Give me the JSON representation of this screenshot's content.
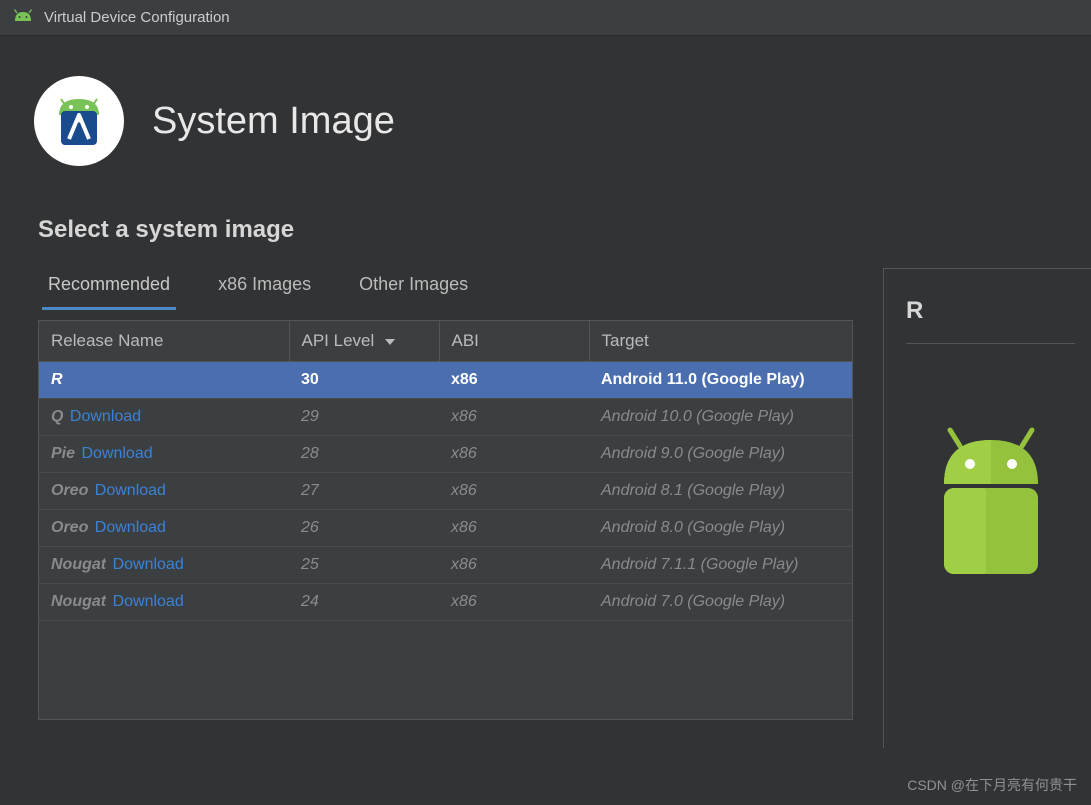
{
  "window": {
    "title": "Virtual Device Configuration"
  },
  "header": {
    "page_title": "System Image"
  },
  "section": {
    "label": "Select a system image"
  },
  "tabs": [
    {
      "label": "Recommended",
      "active": true
    },
    {
      "label": "x86 Images",
      "active": false
    },
    {
      "label": "Other Images",
      "active": false
    }
  ],
  "table": {
    "columns": {
      "release_name": "Release Name",
      "api_level": "API Level",
      "abi": "ABI",
      "target": "Target"
    },
    "download_label": "Download",
    "rows": [
      {
        "name": "R",
        "api": "30",
        "abi": "x86",
        "target": "Android 11.0 (Google Play)",
        "selected": true,
        "downloadable": false
      },
      {
        "name": "Q",
        "api": "29",
        "abi": "x86",
        "target": "Android 10.0 (Google Play)",
        "selected": false,
        "downloadable": true
      },
      {
        "name": "Pie",
        "api": "28",
        "abi": "x86",
        "target": "Android 9.0 (Google Play)",
        "selected": false,
        "downloadable": true
      },
      {
        "name": "Oreo",
        "api": "27",
        "abi": "x86",
        "target": "Android 8.1 (Google Play)",
        "selected": false,
        "downloadable": true
      },
      {
        "name": "Oreo",
        "api": "26",
        "abi": "x86",
        "target": "Android 8.0 (Google Play)",
        "selected": false,
        "downloadable": true
      },
      {
        "name": "Nougat",
        "api": "25",
        "abi": "x86",
        "target": "Android 7.1.1 (Google Play)",
        "selected": false,
        "downloadable": true
      },
      {
        "name": "Nougat",
        "api": "24",
        "abi": "x86",
        "target": "Android 7.0 (Google Play)",
        "selected": false,
        "downloadable": true
      }
    ]
  },
  "detail": {
    "title": "R"
  },
  "watermark": "CSDN @在下月亮有何贵干"
}
